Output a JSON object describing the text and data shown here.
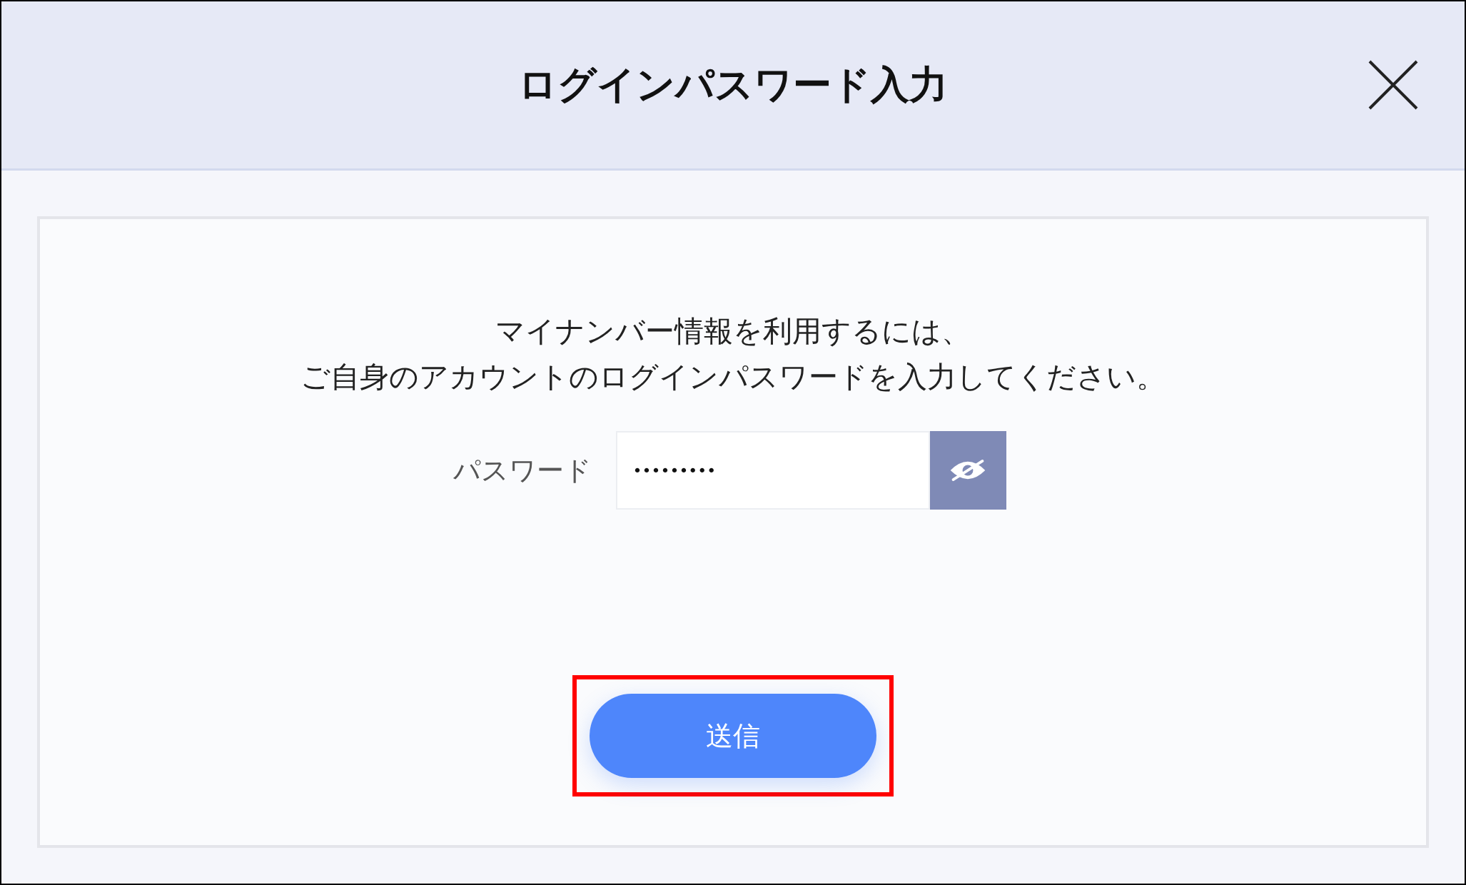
{
  "dialog": {
    "title": "ログインパスワード入力"
  },
  "message": [
    "マイナンバー情報を利用するには、",
    "ご自身のアカウントのログインパスワードを入力してください。"
  ],
  "password": {
    "label": "パスワード",
    "value": "•••••••••",
    "revealed": false
  },
  "submit": {
    "label": "送信",
    "highlighted": true
  }
}
